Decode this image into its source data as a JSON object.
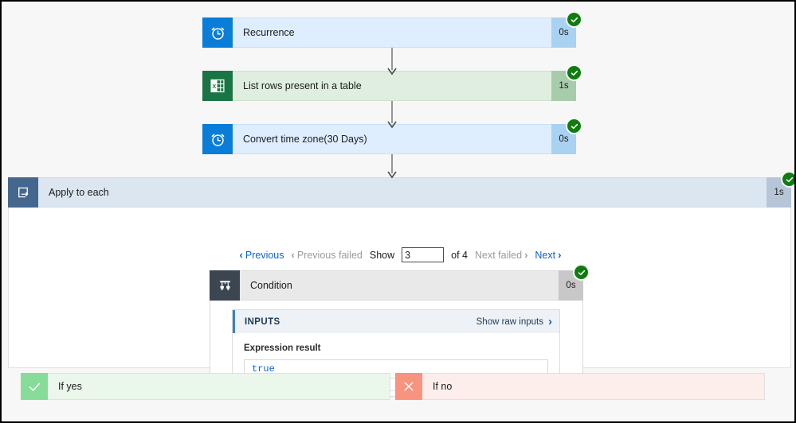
{
  "flow": {
    "nodes": [
      {
        "id": "recurrence",
        "label": "Recurrence",
        "duration": "0s",
        "icon": "alarm-clock-icon",
        "status": "succeeded"
      },
      {
        "id": "list-rows",
        "label": "List rows present in a table",
        "duration": "1s",
        "icon": "excel-icon",
        "status": "succeeded"
      },
      {
        "id": "convert-time-zone",
        "label": "Convert time zone(30 Days)",
        "duration": "0s",
        "icon": "alarm-clock-icon",
        "status": "succeeded"
      }
    ],
    "loop": {
      "label": "Apply to each",
      "duration": "1s",
      "icon": "loop-icon",
      "status": "succeeded"
    },
    "condition": {
      "label": "Condition",
      "duration": "0s",
      "icon": "condition-icon",
      "status": "succeeded"
    }
  },
  "pager": {
    "previous_label": "Previous",
    "previous_failed_label": "Previous failed",
    "show_label": "Show",
    "show_value": "3",
    "of_label": "of 4",
    "next_failed_label": "Next failed",
    "next_label": "Next",
    "chevron_left": "‹",
    "chevron_right": "›"
  },
  "inputs_panel": {
    "title": "INPUTS",
    "raw_inputs_label": "Show raw inputs",
    "raw_inputs_chevron": "›",
    "expression_label": "Expression result",
    "expression_value": "true"
  },
  "branches": {
    "yes": {
      "label": "If yes",
      "icon": "checkmark-icon"
    },
    "no": {
      "label": "If no",
      "icon": "cross-icon"
    }
  },
  "colors": {
    "accent_blue": "#0a63c9",
    "trigger_blue": "#0a7dd8",
    "excel_green": "#1a7545",
    "loop_blue": "#44678e",
    "condition_gray": "#3b4651",
    "success_green": "#107c10",
    "yes_green": "#87dc9a",
    "no_red": "#f8937f"
  }
}
